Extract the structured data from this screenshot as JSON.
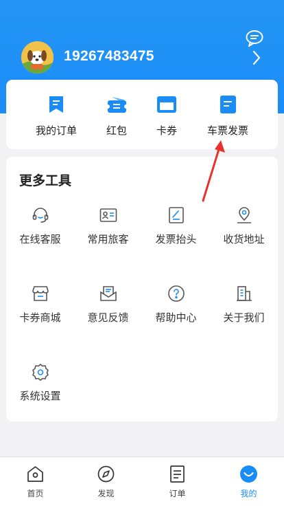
{
  "profile": {
    "phone": "19267483475"
  },
  "quick_actions": [
    {
      "label": "我的订单",
      "icon": "order-bookmark-icon"
    },
    {
      "label": "红包",
      "icon": "red-packet-icon"
    },
    {
      "label": "卡券",
      "icon": "coupon-card-icon"
    },
    {
      "label": "车票发票",
      "icon": "ticket-invoice-icon"
    }
  ],
  "tools": {
    "title": "更多工具",
    "items": [
      {
        "label": "在线客服",
        "icon": "headset-icon"
      },
      {
        "label": "常用旅客",
        "icon": "id-card-icon"
      },
      {
        "label": "发票抬头",
        "icon": "invoice-edit-icon"
      },
      {
        "label": "收货地址",
        "icon": "location-pin-icon"
      },
      {
        "label": "卡券商城",
        "icon": "store-icon"
      },
      {
        "label": "意见反馈",
        "icon": "feedback-mail-icon"
      },
      {
        "label": "帮助中心",
        "icon": "help-icon"
      },
      {
        "label": "关于我们",
        "icon": "building-icon"
      },
      {
        "label": "系统设置",
        "icon": "gear-icon"
      }
    ]
  },
  "tabbar": {
    "items": [
      {
        "label": "首页",
        "icon": "home-icon"
      },
      {
        "label": "发现",
        "icon": "compass-icon"
      },
      {
        "label": "订单",
        "icon": "order-list-icon"
      },
      {
        "label": "我的",
        "icon": "profile-smile-icon",
        "active": true
      }
    ]
  },
  "colors": {
    "brand_blue": "#1a8cf5",
    "annotation_red": "#e8322b"
  }
}
